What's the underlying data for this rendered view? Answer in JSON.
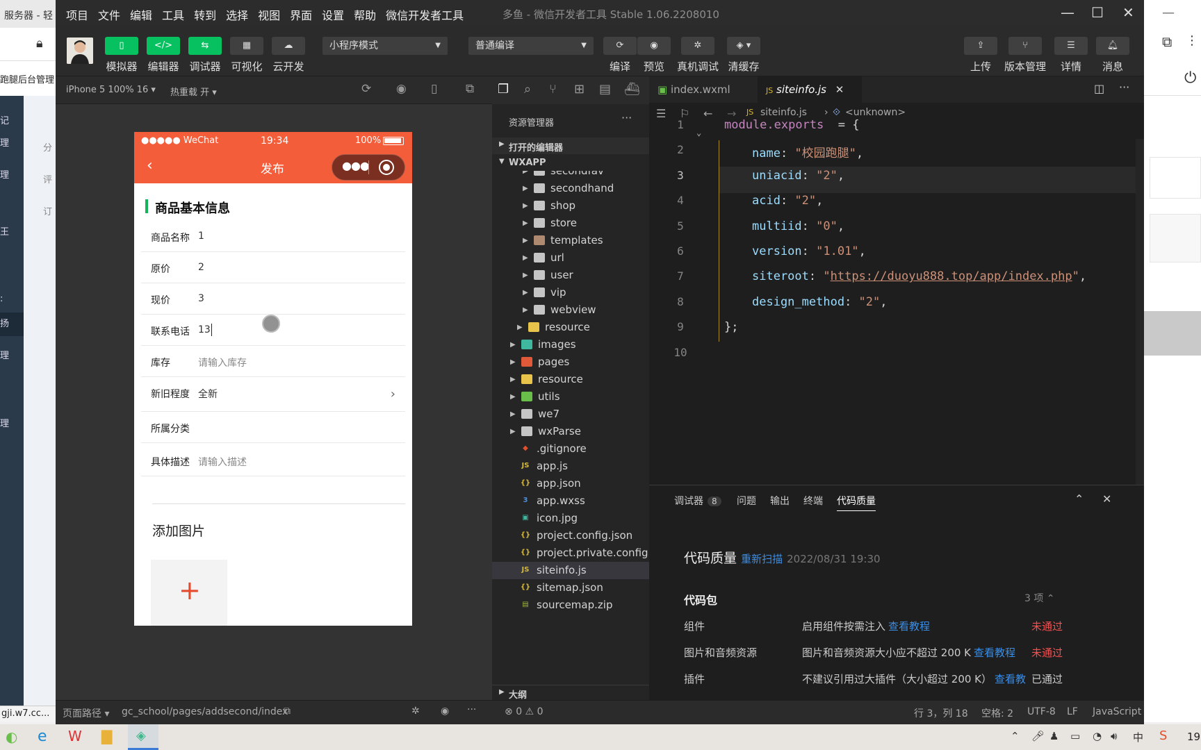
{
  "background": {
    "browser_tab": "服务器 - 轻",
    "nav_text": "跑腿后台管理",
    "side_items": [
      "记",
      "理",
      "理",
      "王",
      "",
      ":",
      "扬",
      "理",
      "",
      "理"
    ],
    "mid_items": [
      "分",
      "评",
      "订"
    ],
    "status_url": "gji.w7.cc..."
  },
  "window": {
    "menu": [
      "项目",
      "文件",
      "编辑",
      "工具",
      "转到",
      "选择",
      "视图",
      "界面",
      "设置",
      "帮助",
      "微信开发者工具"
    ],
    "title": "多鱼 - 微信开发者工具 Stable 1.06.2208010",
    "controls": {
      "min": "—",
      "max": "☐",
      "close": "✕"
    }
  },
  "toolbar": {
    "left": [
      {
        "icon": "phone-icon",
        "label": "模拟器",
        "active": true
      },
      {
        "icon": "code-icon",
        "label": "编辑器",
        "active": true
      },
      {
        "icon": "debug-icon",
        "label": "调试器",
        "active": true
      },
      {
        "icon": "visual-icon",
        "label": "可视化",
        "active": false
      },
      {
        "icon": "cloud-icon",
        "label": "云开发",
        "active": false
      }
    ],
    "mode_select": "小程序模式",
    "compile_select": "普通编译",
    "mid": [
      {
        "icon": "refresh-icon",
        "label": "编译"
      },
      {
        "icon": "eye-icon",
        "label": "预览"
      },
      {
        "icon": "bug-icon",
        "label": "真机调试"
      },
      {
        "icon": "layers-icon",
        "label": "清缓存"
      }
    ],
    "right": [
      {
        "icon": "upload-icon",
        "label": "上传"
      },
      {
        "icon": "branch-icon",
        "label": "版本管理"
      },
      {
        "icon": "menu-icon",
        "label": "详情"
      },
      {
        "icon": "bell-icon",
        "label": "消息"
      }
    ]
  },
  "simulator": {
    "device": "iPhone 5 100% 16",
    "hot_reload": "热重载 开",
    "status_left": "●●●●● WeChat",
    "status_time": "19:34",
    "status_battery": "100%",
    "nav_title": "发布",
    "section_title": "商品基本信息",
    "fields": [
      {
        "label": "商品名称",
        "value": "1",
        "placeholder": false
      },
      {
        "label": "原价",
        "value": "2",
        "placeholder": false
      },
      {
        "label": "现价",
        "value": "3",
        "placeholder": false
      },
      {
        "label": "联系电话",
        "value": "13",
        "placeholder": false
      },
      {
        "label": "库存",
        "value": "请输入库存",
        "placeholder": true
      },
      {
        "label": "新旧程度",
        "value": "全新",
        "placeholder": false
      },
      {
        "label": "所属分类",
        "value": "",
        "placeholder": false
      },
      {
        "label": "具体描述",
        "value": "请输入描述",
        "placeholder": true
      }
    ],
    "add_image": "添加图片",
    "add_plus": "+"
  },
  "explorer": {
    "title": "资源管理器",
    "open_editors": "打开的编辑器",
    "root": "WXAPP",
    "outline": "大纲",
    "items": [
      {
        "name": "secondfav",
        "type": "folder",
        "depth": 2,
        "color": "#c5c5c5"
      },
      {
        "name": "secondhand",
        "type": "folder",
        "depth": 2,
        "color": "#c5c5c5"
      },
      {
        "name": "shop",
        "type": "folder",
        "depth": 2,
        "color": "#c5c5c5"
      },
      {
        "name": "store",
        "type": "folder",
        "depth": 2,
        "color": "#c5c5c5"
      },
      {
        "name": "templates",
        "type": "folder",
        "depth": 2,
        "color": "#b08a70"
      },
      {
        "name": "url",
        "type": "folder",
        "depth": 2,
        "color": "#c5c5c5"
      },
      {
        "name": "user",
        "type": "folder",
        "depth": 2,
        "color": "#c5c5c5"
      },
      {
        "name": "vip",
        "type": "folder",
        "depth": 2,
        "color": "#c5c5c5"
      },
      {
        "name": "webview",
        "type": "folder",
        "depth": 2,
        "color": "#c5c5c5"
      },
      {
        "name": "resource",
        "type": "folder",
        "depth": 1,
        "color": "#e8c44a"
      },
      {
        "name": "images",
        "type": "folder",
        "depth": 0,
        "color": "#3fb8a0"
      },
      {
        "name": "pages",
        "type": "folder",
        "depth": 0,
        "color": "#e05a3a"
      },
      {
        "name": "resource",
        "type": "folder",
        "depth": 0,
        "color": "#e8c44a"
      },
      {
        "name": "utils",
        "type": "folder",
        "depth": 0,
        "color": "#6abf4b"
      },
      {
        "name": "we7",
        "type": "folder",
        "depth": 0,
        "color": "#c5c5c5"
      },
      {
        "name": "wxParse",
        "type": "folder",
        "depth": 0,
        "color": "#c5c5c5"
      },
      {
        "name": ".gitignore",
        "type": "file",
        "depth": 0,
        "color": "#e0502c",
        "glyph": "◆"
      },
      {
        "name": "app.js",
        "type": "file",
        "depth": 0,
        "color": "#d7b93a",
        "glyph": "JS"
      },
      {
        "name": "app.json",
        "type": "file",
        "depth": 0,
        "color": "#d7b93a",
        "glyph": "{}"
      },
      {
        "name": "app.wxss",
        "type": "file",
        "depth": 0,
        "color": "#4a8fe0",
        "glyph": "3"
      },
      {
        "name": "icon.jpg",
        "type": "file",
        "depth": 0,
        "color": "#3fb8a0",
        "glyph": "▣"
      },
      {
        "name": "project.config.json",
        "type": "file",
        "depth": 0,
        "color": "#d7b93a",
        "glyph": "{}"
      },
      {
        "name": "project.private.config.js...",
        "type": "file",
        "depth": 0,
        "color": "#d7b93a",
        "glyph": "{}"
      },
      {
        "name": "siteinfo.js",
        "type": "file",
        "depth": 0,
        "color": "#d7b93a",
        "glyph": "JS",
        "selected": true
      },
      {
        "name": "sitemap.json",
        "type": "file",
        "depth": 0,
        "color": "#d7b93a",
        "glyph": "{}"
      },
      {
        "name": "sourcemap.zip",
        "type": "file",
        "depth": 0,
        "color": "#9ab33c",
        "glyph": "▤"
      }
    ]
  },
  "editor": {
    "tabs": [
      {
        "name": "index.wxml",
        "active": false
      },
      {
        "name": "siteinfo.js",
        "active": true
      }
    ],
    "breadcrumb": {
      "file": "siteinfo.js",
      "symbol": "<unknown>"
    },
    "current_line": 3,
    "lines": [
      {
        "n": "1",
        "parts": [
          [
            "pp",
            "module.exports"
          ],
          [
            "",
            "  = {"
          ]
        ]
      },
      {
        "n": "2",
        "parts": [
          [
            "kk",
            "name"
          ],
          [
            "",
            ": "
          ],
          [
            "ss",
            "\"校园跑腿\""
          ],
          [
            "",
            ","
          ]
        ]
      },
      {
        "n": "3",
        "parts": [
          [
            "kk",
            "uniacid"
          ],
          [
            "",
            ": "
          ],
          [
            "ss",
            "\"2\""
          ],
          [
            "",
            ","
          ]
        ]
      },
      {
        "n": "4",
        "parts": [
          [
            "kk",
            "acid"
          ],
          [
            "",
            ": "
          ],
          [
            "ss",
            "\"2\""
          ],
          [
            "",
            ","
          ]
        ]
      },
      {
        "n": "5",
        "parts": [
          [
            "kk",
            "multiid"
          ],
          [
            "",
            ": "
          ],
          [
            "ss",
            "\"0\""
          ],
          [
            "",
            ","
          ]
        ]
      },
      {
        "n": "6",
        "parts": [
          [
            "kk",
            "version"
          ],
          [
            "",
            ": "
          ],
          [
            "ss",
            "\"1.01\""
          ],
          [
            "",
            ","
          ]
        ]
      },
      {
        "n": "7",
        "parts": [
          [
            "kk",
            "siteroot"
          ],
          [
            "",
            ": "
          ],
          [
            "ss",
            "\""
          ],
          [
            "url",
            "https://duoyu888.top/app/index.php"
          ],
          [
            "ss",
            "\""
          ],
          [
            "",
            ","
          ]
        ]
      },
      {
        "n": "8",
        "parts": [
          [
            "kk",
            "design_method"
          ],
          [
            "",
            ": "
          ],
          [
            "ss",
            "\"2\""
          ],
          [
            "",
            ","
          ]
        ]
      },
      {
        "n": "9",
        "parts": [
          [
            "",
            "};"
          ]
        ]
      },
      {
        "n": "10",
        "parts": []
      }
    ]
  },
  "panel": {
    "tabs": [
      {
        "label": "调试器",
        "badge": "8"
      },
      {
        "label": "问题"
      },
      {
        "label": "输出"
      },
      {
        "label": "终端"
      },
      {
        "label": "代码质量",
        "active": true
      }
    ],
    "title": "代码质量",
    "rescan": "重新扫描",
    "time": "2022/08/31 19:30",
    "group": "代码包",
    "group_count": "3 项",
    "rows": [
      {
        "name": "组件",
        "desc": "启用组件按需注入",
        "link": "查看教程",
        "result": "未通过",
        "fail": true
      },
      {
        "name": "图片和音频资源",
        "desc": "图片和音频资源大小应不超过 200 K",
        "link": "查看教程",
        "result": "未通过",
        "fail": true
      },
      {
        "name": "插件",
        "desc": "不建议引用过大插件（大小超过 200 K）",
        "link": "查看教",
        "result": "已通过",
        "fail": false
      }
    ]
  },
  "statusbar": {
    "page_path_label": "页面路径",
    "page_path": "gc_school/pages/addsecond/index",
    "errors": "0",
    "warnings": "0",
    "position": "行 3，列 18",
    "spaces": "空格: 2",
    "encoding": "UTF-8",
    "eol": "LF",
    "language": "JavaScript"
  },
  "taskbar": {
    "clock": "19"
  }
}
